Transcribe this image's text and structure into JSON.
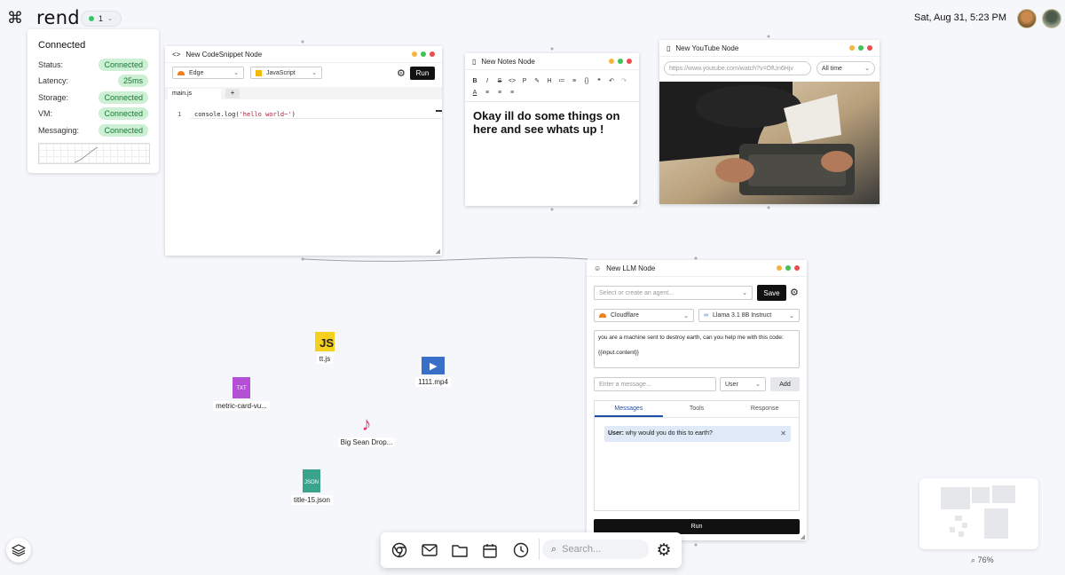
{
  "brand": {
    "cmd_glyph": "⌘",
    "name": "rend"
  },
  "workspace": {
    "count": "1"
  },
  "datetime": "Sat, Aug 31, 5:23 PM",
  "status": {
    "title": "Connected",
    "rows": [
      {
        "label": "Status:",
        "value": "Connected"
      },
      {
        "label": "Latency:",
        "value": "25ms"
      },
      {
        "label": "Storage:",
        "value": "Connected"
      },
      {
        "label": "VM:",
        "value": "Connected"
      },
      {
        "label": "Messaging:",
        "value": "Connected"
      }
    ]
  },
  "code_node": {
    "title": "New CodeSnippet Node",
    "runtime": "Edge",
    "language": "JavaScript",
    "run_label": "Run",
    "tab": "main.js",
    "add_tab": "+",
    "line_no": "1",
    "code_prefix": "console.log(",
    "code_string": "'hello world~'",
    "code_suffix": ")"
  },
  "notes_node": {
    "title": "New Notes Node",
    "content": "Okay ill do some things on here and see whats up !",
    "toolbar": [
      "B",
      "I",
      "S",
      "<>",
      "P",
      "✎",
      "H",
      "≔",
      "≡",
      "{}",
      "❝",
      "↶",
      "↷"
    ]
  },
  "youtube_node": {
    "title": "New YouTube Node",
    "url": "https://www.youtube.com/watch?v=OfUn6Hjv",
    "filter": "All time"
  },
  "llm_node": {
    "title": "New LLM Node",
    "agent_placeholder": "Select or create an agent...",
    "save_label": "Save",
    "provider": "Cloudflare",
    "model": "Llama 3.1 8B Instruct",
    "prompt_line1": "you are a machine sent to destroy earth, can you help me with this code:",
    "prompt_line2": "{{input.content}}",
    "message_placeholder": "Enter a message...",
    "role": "User",
    "add_label": "Add",
    "tabs": [
      "Messages",
      "Tools",
      "Response"
    ],
    "message_role": "User:",
    "message_text": "why would you do this to earth?",
    "run_label": "Run"
  },
  "desktop_files": [
    {
      "name": "tt.js"
    },
    {
      "name": "1111.mp4"
    },
    {
      "name": "metric-card-vu..."
    },
    {
      "name": "Big Sean Drop..."
    },
    {
      "name": "title-15.json"
    }
  ],
  "dock": {
    "search_placeholder": "Search..."
  },
  "zoom": "76%",
  "colors": {
    "accent": "#2563eb",
    "connected_bg": "#cdf0d4",
    "connected_fg": "#157a36"
  }
}
